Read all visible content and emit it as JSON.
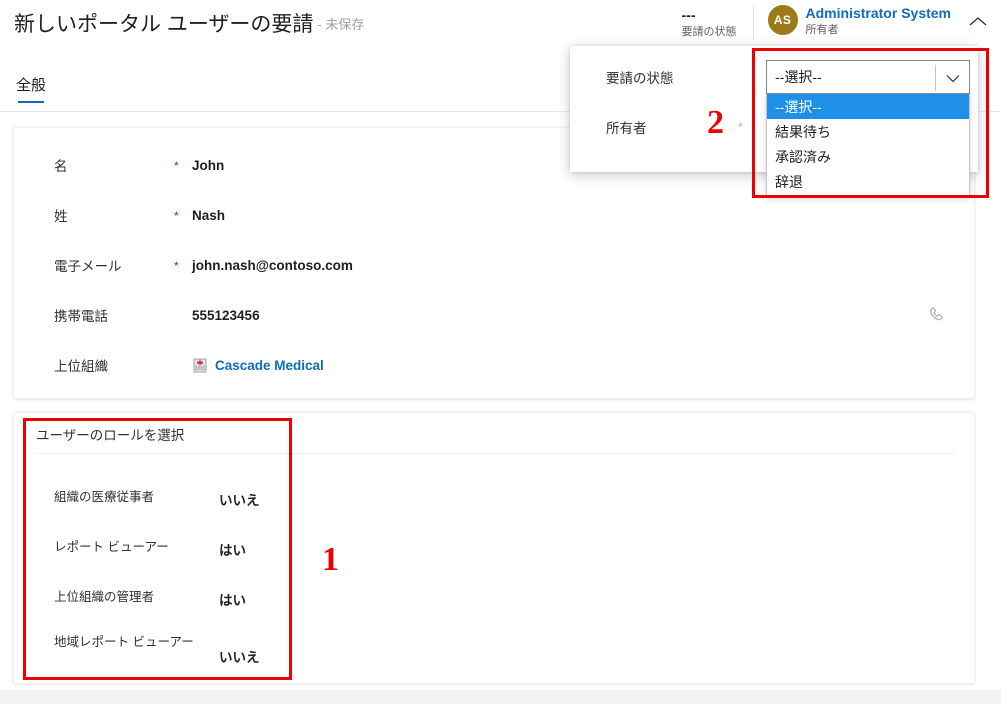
{
  "header": {
    "title": "新しいポータル ユーザーの要請",
    "unsaved_suffix": "- 未保存",
    "status_value": "---",
    "status_label": "要請の状態",
    "owner_initials": "AS",
    "owner_name": "Administrator System",
    "owner_label": "所有者",
    "collapse_icon": "chevron-up-icon"
  },
  "tabs": [
    {
      "label": "全般",
      "active": true
    }
  ],
  "general_card": {
    "fields": [
      {
        "label": "名",
        "required": "*",
        "value": "John",
        "type": "text"
      },
      {
        "label": "姓",
        "required": "*",
        "value": "Nash",
        "type": "text"
      },
      {
        "label": "電子メール",
        "required": "*",
        "value": "john.nash@contoso.com",
        "type": "text"
      },
      {
        "label": "携帯電話",
        "required": "",
        "value": "555123456",
        "type": "phone"
      },
      {
        "label": "上位組織",
        "required": "",
        "value": "Cascade Medical",
        "type": "lookup"
      }
    ],
    "phone_icon": "phone-call-icon",
    "org_icon": "hospital-building-icon"
  },
  "roles_card": {
    "title": "ユーザーのロールを選択",
    "rows": [
      {
        "label": "組織の医療従事者",
        "value": "いいえ"
      },
      {
        "label": "レポート ビューアー",
        "value": "はい"
      },
      {
        "label": "上位組織の管理者",
        "value": "はい"
      },
      {
        "label": "地域レポート ビューアー",
        "value": "いいえ"
      }
    ]
  },
  "flyout": {
    "rows": [
      {
        "label": "要請の状態",
        "required": ""
      },
      {
        "label": "所有者",
        "required": "*"
      }
    ]
  },
  "status_select": {
    "selected": "--選択--",
    "caret_icon": "chevron-down-icon",
    "options": [
      {
        "label": "--選択--",
        "selected": true
      },
      {
        "label": "結果待ち",
        "selected": false
      },
      {
        "label": "承認済み",
        "selected": false
      },
      {
        "label": "辞退",
        "selected": false
      }
    ]
  },
  "annotations": [
    {
      "number": "1",
      "target": "roles-card"
    },
    {
      "number": "2",
      "target": "status-select"
    }
  ],
  "colors": {
    "accent": "#0f6cbd",
    "required": "#a4262c",
    "annotation": "#ee0000",
    "avatar": "#9a7b17",
    "highlight": "#1e90e8"
  }
}
